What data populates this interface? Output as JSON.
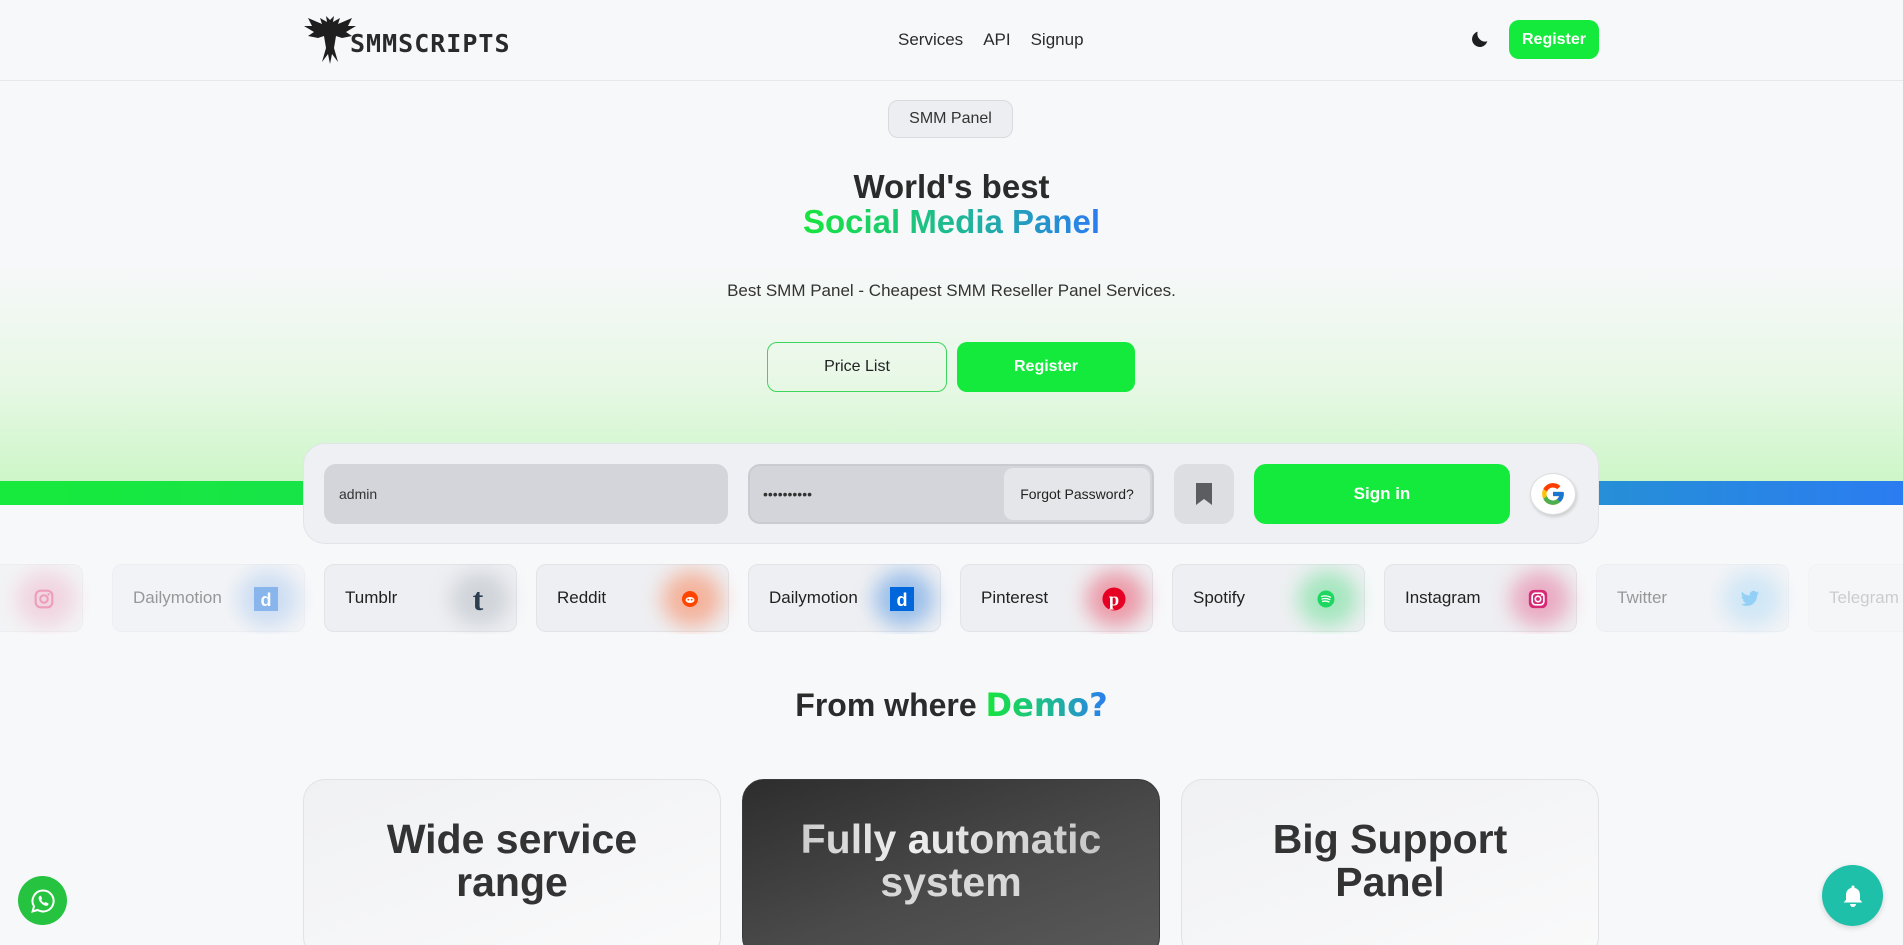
{
  "header": {
    "logo_text": "SMMSCRIPTS",
    "nav": [
      "Services",
      "API",
      "Signup"
    ],
    "register_label": "Register"
  },
  "hero": {
    "badge": "SMM Panel",
    "title_line1": "World's best",
    "title_line2": "Social Media Panel",
    "subtitle": "Best SMM Panel - Cheapest SMM Reseller Panel Services.",
    "price_list_label": "Price List",
    "register_label": "Register"
  },
  "login": {
    "username_value": "admin",
    "password_value": "••••••••••",
    "forgot_label": "Forgot Password?",
    "signin_label": "Sign in"
  },
  "platforms": [
    {
      "name": "",
      "icon": "instagram-icon",
      "color": "#e1306c"
    },
    {
      "name": "Dailymotion",
      "icon": "dailymotion-icon",
      "color": "#0066dc"
    },
    {
      "name": "Tumblr",
      "icon": "tumblr-icon",
      "color": "#2c3e50"
    },
    {
      "name": "Reddit",
      "icon": "reddit-icon",
      "color": "#ff4500"
    },
    {
      "name": "Dailymotion",
      "icon": "dailymotion-icon",
      "color": "#0066dc"
    },
    {
      "name": "Pinterest",
      "icon": "pinterest-icon",
      "color": "#e60023"
    },
    {
      "name": "Spotify",
      "icon": "spotify-icon",
      "color": "#1ed760"
    },
    {
      "name": "Instagram",
      "icon": "instagram-icon",
      "color": "#e1306c"
    },
    {
      "name": "Twitter",
      "icon": "twitter-icon",
      "color": "#1da1f2"
    },
    {
      "name": "Telegram",
      "icon": "telegram-icon",
      "color": "#229ed9"
    }
  ],
  "demo": {
    "title_plain": "From where",
    "title_highlight": "Demo?"
  },
  "cards": [
    {
      "line1": "Wide service",
      "line2": "range"
    },
    {
      "line1": "Fully automatic",
      "line2": "system"
    },
    {
      "line1": "Big Support",
      "line2": "Panel"
    }
  ],
  "colors": {
    "accent_green": "#14ea3c",
    "accent_blue": "#2b7cf1",
    "bell_teal": "#1fc0a9",
    "whatsapp_green": "#25c33f"
  }
}
